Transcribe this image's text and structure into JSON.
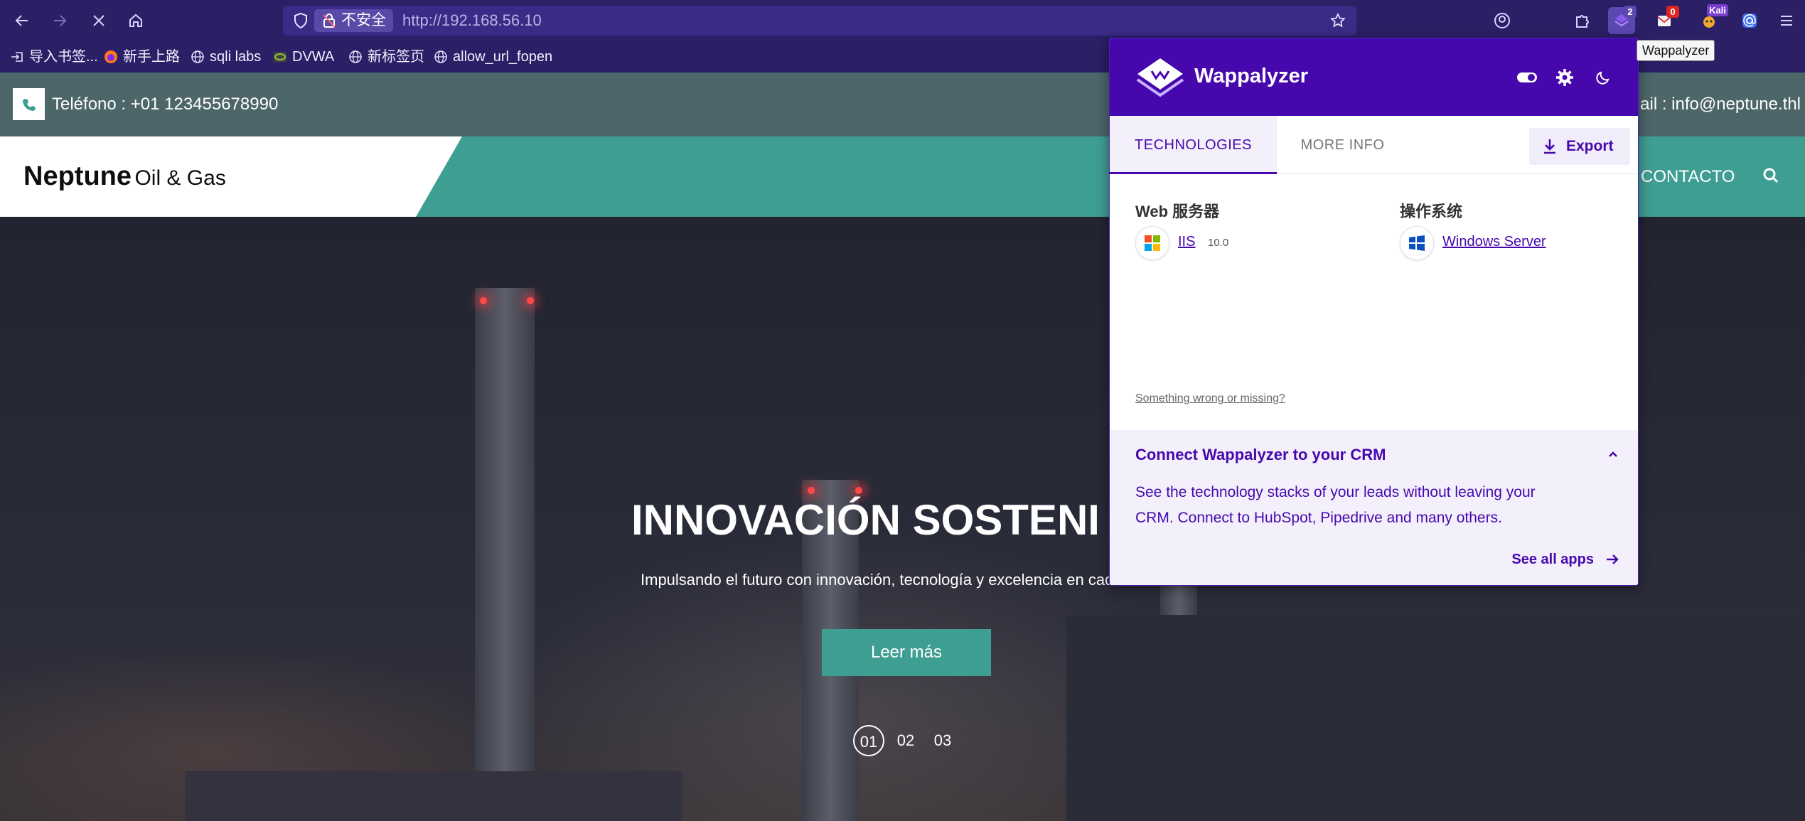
{
  "browser": {
    "url_security": "不安全",
    "url": "http://192.168.56.10",
    "extensions": {
      "wappalyzer_badge": "2",
      "mail_badge": "0",
      "kali_label": "Kali"
    },
    "tooltip": "Wappalyzer"
  },
  "bookmarks": [
    {
      "label": "导入书签...",
      "icon": "import-icon"
    },
    {
      "label": "新手上路",
      "icon": "firefox-icon"
    },
    {
      "label": "sqli labs",
      "icon": "globe-icon"
    },
    {
      "label": "DVWA",
      "icon": "dvwa-icon"
    },
    {
      "label": "新标签页",
      "icon": "globe-icon"
    },
    {
      "label": "allow_url_fopen",
      "icon": "globe-icon"
    }
  ],
  "site": {
    "phone": "Teléfono : +01 123455678990",
    "email": "ail : info@neptune.thl",
    "logo_bold": "Neptune",
    "logo_rest": "Oil & Gas",
    "nav_contact": "CONTACTO",
    "hero_title": "INNOVACIÓN SOSTENI",
    "hero_subtitle": "Impulsando el futuro con innovación, tecnología y excelencia en cad",
    "hero_button": "Leer más",
    "slides": [
      "01",
      "02",
      "03"
    ],
    "colors": {
      "teal": "#3f9e92",
      "topbar": "#4c6669"
    }
  },
  "wappalyzer": {
    "brand": "Wappalyzer",
    "tabs": {
      "technologies": "TECHNOLOGIES",
      "more_info": "MORE INFO"
    },
    "export_label": "Export",
    "categories": [
      {
        "name": "Web 服务器",
        "tech": "IIS",
        "version": "10.0",
        "icon": "windows-color-icon"
      },
      {
        "name": "操作系统",
        "tech": "Windows Server",
        "version": "",
        "icon": "windows-blue-icon"
      }
    ],
    "wrong_link": "Something wrong or missing?",
    "crm": {
      "title": "Connect Wappalyzer to your CRM",
      "body": "See the technology stacks of your leads without leaving your CRM. Connect to HubSpot, Pipedrive and many others.",
      "link": "See all apps"
    },
    "colors": {
      "brand": "#4608ad"
    }
  }
}
